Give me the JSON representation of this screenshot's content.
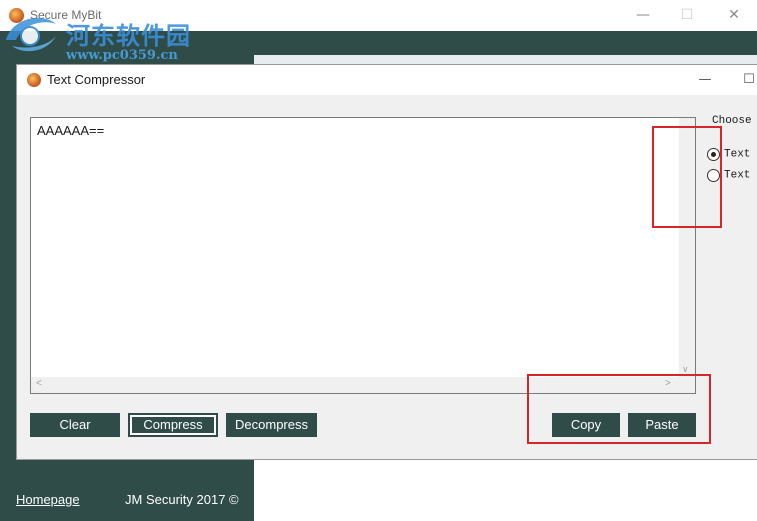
{
  "outer_window": {
    "title": "Secure MyBit",
    "minimize_glyph": "—",
    "maximize_glyph": "☐",
    "close_glyph": "✕",
    "homepage_link": "Homepage",
    "copyright": "JM Security 2017 ©"
  },
  "watermark": {
    "title": "河东软件园",
    "url": "www.pc0359.cn"
  },
  "front_window": {
    "title": "Text Compressor",
    "minimize_glyph": "—",
    "maximize_glyph": "☐"
  },
  "text_area": {
    "value": "AAAAAA==",
    "scroll_down_glyph": "∨",
    "scroll_left_glyph": "<",
    "scroll_right_glyph": ">"
  },
  "options": {
    "label": "Choose a",
    "radios": [
      {
        "label": "Text C",
        "checked": true
      },
      {
        "label": "Text D",
        "checked": false
      }
    ]
  },
  "buttons": {
    "clear": "Clear",
    "compress": "Compress",
    "decompress": "Decompress",
    "copy": "Copy",
    "paste": "Paste"
  },
  "colors": {
    "accent": "#2f4c48",
    "annotation": "#d6262a"
  }
}
